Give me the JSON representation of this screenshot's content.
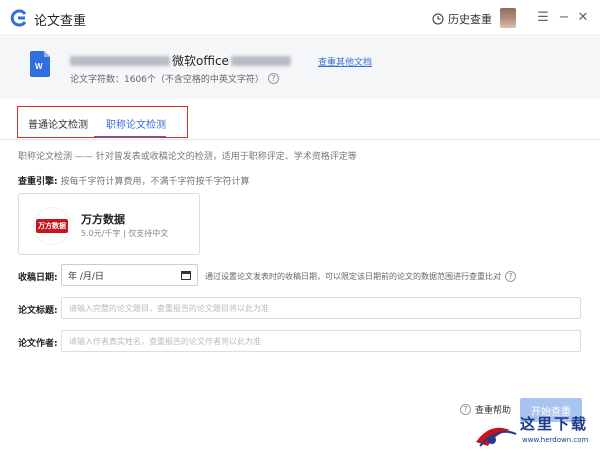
{
  "titlebar": {
    "app_title": "论文查重",
    "history_label": "历史查重",
    "menu_icon": "hamburger-icon",
    "minimize_icon": "minimize-icon",
    "close_icon": "close-icon"
  },
  "document": {
    "title_visible": "微软office",
    "other_doc_link": "查重其他文档",
    "word_count": "论文字符数：1606个（不含空格的中英文字符）"
  },
  "tabs": [
    {
      "label": "普通论文检测",
      "active": false
    },
    {
      "label": "职称论文检测",
      "active": true
    }
  ],
  "description": "职称论文检测 —— 针对曾发表或收稿论文的检测，适用于职称评定、学术资格评定等",
  "engine": {
    "label": "查重引擎:",
    "note": "按每千字符计算费用，不满千字符按千字符计算",
    "name": "万方数据",
    "price": "5.0元/千字 | 仅支持中文",
    "logo_text": "万方数据"
  },
  "form": {
    "date_label": "收稿日期:",
    "date_value": "年 /月/日",
    "date_note": "通过设置论文发表时的收稿日期，可以限定该日期前的论文的数据范围进行查重比对",
    "title_label": "论文标题:",
    "title_placeholder": "请输入完整的论文题目，查重报告的论文题目将以此为准",
    "author_label": "论文作者:",
    "author_placeholder": "请输入作者真实姓名，查重报告的论文作者将以此为准"
  },
  "footer": {
    "help_label": "查重帮助",
    "start_button": "开始查重"
  },
  "watermark": {
    "text": "这里下载",
    "url": "www.herdown.com"
  },
  "colors": {
    "accent": "#3a6fd8",
    "highlight_box": "#e02b2b",
    "button_disabled": "#a9c4f0",
    "brand_red": "#c8151d"
  }
}
